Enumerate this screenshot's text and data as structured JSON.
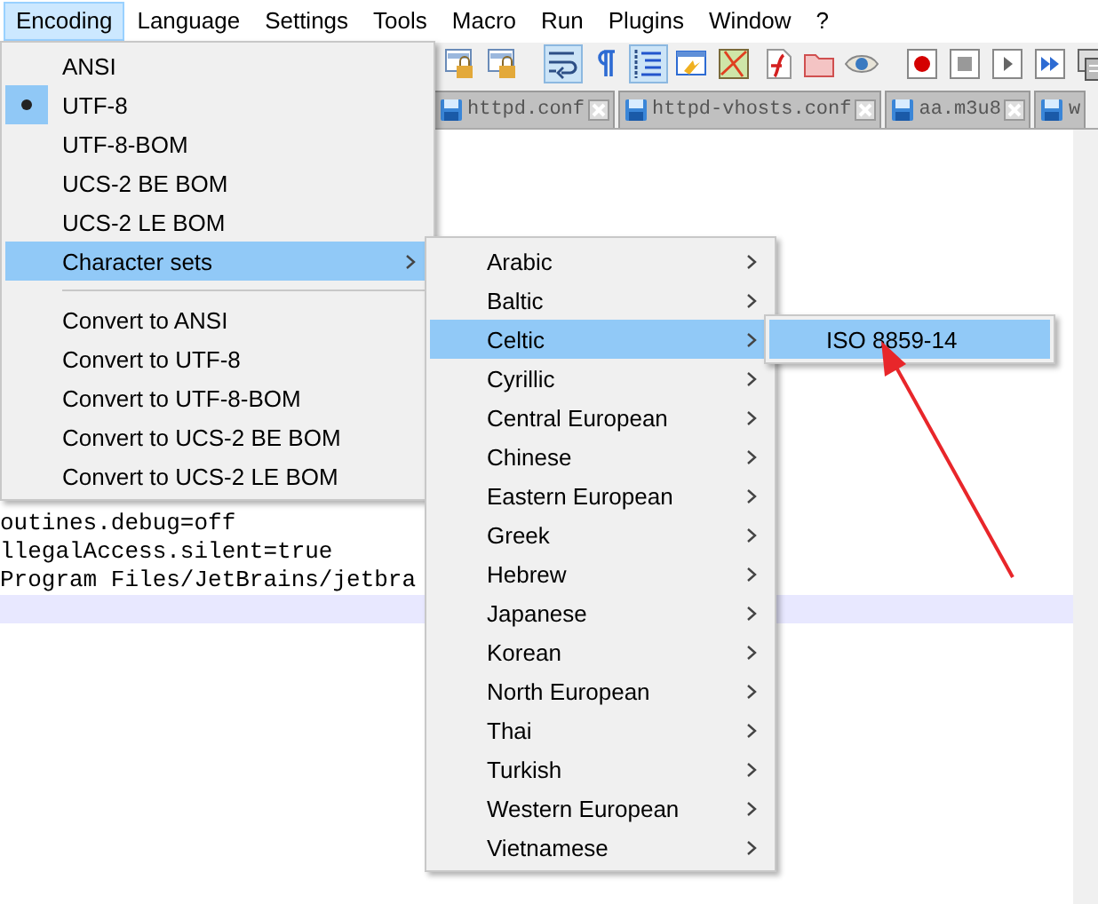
{
  "menubar": [
    {
      "label": "Encoding",
      "selected": true
    },
    {
      "label": "Language",
      "selected": false
    },
    {
      "label": "Settings",
      "selected": false
    },
    {
      "label": "Tools",
      "selected": false
    },
    {
      "label": "Macro",
      "selected": false
    },
    {
      "label": "Run",
      "selected": false
    },
    {
      "label": "Plugins",
      "selected": false
    },
    {
      "label": "Window",
      "selected": false
    },
    {
      "label": "?",
      "selected": false
    }
  ],
  "toolbar": [
    {
      "kind": "lock",
      "on": false
    },
    {
      "kind": "lock",
      "on": false
    },
    {
      "kind": "separator"
    },
    {
      "kind": "wrap",
      "on": true
    },
    {
      "kind": "pilcrow",
      "on": false
    },
    {
      "kind": "indent",
      "on": true
    },
    {
      "kind": "panel",
      "on": false
    },
    {
      "kind": "map",
      "on": false
    },
    {
      "kind": "function",
      "on": false
    },
    {
      "kind": "folder",
      "on": false
    },
    {
      "kind": "eye",
      "on": false
    },
    {
      "kind": "separator"
    },
    {
      "kind": "record",
      "on": false
    },
    {
      "kind": "stop",
      "on": false
    },
    {
      "kind": "play",
      "on": false
    },
    {
      "kind": "fast-forward",
      "on": false
    },
    {
      "kind": "macro-list",
      "on": false
    }
  ],
  "tabs": [
    {
      "label": "httpd.conf",
      "selected": false
    },
    {
      "label": "httpd-vhosts.conf",
      "selected": false
    },
    {
      "label": "aa.m3u8",
      "selected": false
    },
    {
      "label": "w",
      "selected": false
    }
  ],
  "editor_lines": [
    "outines.debug=off",
    "llegalAccess.silent=true",
    "Program Files/JetBrains/jetbra"
  ],
  "encoding_menu": [
    {
      "kind": "item",
      "label": "ANSI",
      "checked": false,
      "selected": false
    },
    {
      "kind": "item",
      "label": "UTF-8",
      "checked": true,
      "selected": false
    },
    {
      "kind": "item",
      "label": "UTF-8-BOM",
      "checked": false,
      "selected": false
    },
    {
      "kind": "item",
      "label": "UCS-2 BE BOM",
      "checked": false,
      "selected": false
    },
    {
      "kind": "item",
      "label": "UCS-2 LE BOM",
      "checked": false,
      "selected": false
    },
    {
      "kind": "submenu",
      "label": "Character sets",
      "checked": false,
      "selected": true
    },
    {
      "kind": "separator"
    },
    {
      "kind": "item",
      "label": "Convert to ANSI",
      "checked": false,
      "selected": false
    },
    {
      "kind": "item",
      "label": "Convert to UTF-8",
      "checked": false,
      "selected": false
    },
    {
      "kind": "item",
      "label": "Convert to UTF-8-BOM",
      "checked": false,
      "selected": false
    },
    {
      "kind": "item",
      "label": "Convert to UCS-2 BE BOM",
      "checked": false,
      "selected": false
    },
    {
      "kind": "item",
      "label": "Convert to UCS-2 LE BOM",
      "checked": false,
      "selected": false
    }
  ],
  "character_sets_menu": [
    {
      "label": "Arabic",
      "selected": false
    },
    {
      "label": "Baltic",
      "selected": false
    },
    {
      "label": "Celtic",
      "selected": true
    },
    {
      "label": "Cyrillic",
      "selected": false
    },
    {
      "label": "Central European",
      "selected": false
    },
    {
      "label": "Chinese",
      "selected": false
    },
    {
      "label": "Eastern European",
      "selected": false
    },
    {
      "label": "Greek",
      "selected": false
    },
    {
      "label": "Hebrew",
      "selected": false
    },
    {
      "label": "Japanese",
      "selected": false
    },
    {
      "label": "Korean",
      "selected": false
    },
    {
      "label": "North European",
      "selected": false
    },
    {
      "label": "Thai",
      "selected": false
    },
    {
      "label": "Turkish",
      "selected": false
    },
    {
      "label": "Western European",
      "selected": false
    },
    {
      "label": "Vietnamese",
      "selected": false
    }
  ],
  "celtic_menu": [
    {
      "label": "ISO 8859-14",
      "selected": true
    }
  ]
}
